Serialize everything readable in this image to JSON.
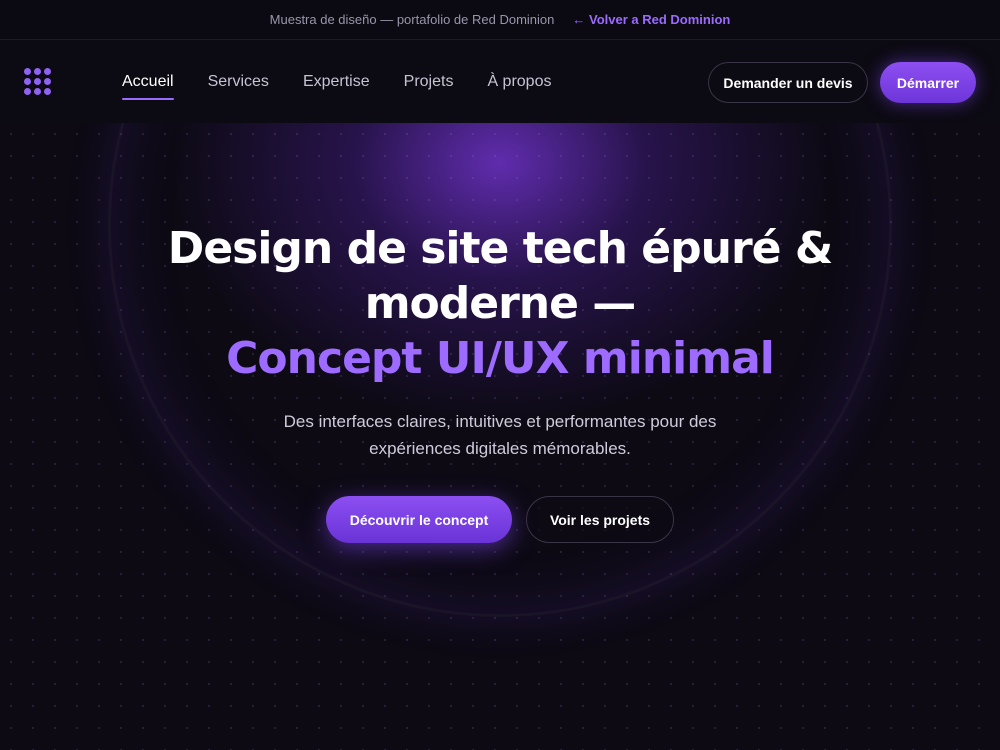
{
  "banner": {
    "text": "Muestra de diseño — portafolio de Red Dominion",
    "back_link": "← Volver a Red Dominion"
  },
  "nav": {
    "logo_icon": "dot-grid-icon",
    "links": [
      {
        "label": "Accueil",
        "active": true
      },
      {
        "label": "Services",
        "active": false
      },
      {
        "label": "Expertise",
        "active": false
      },
      {
        "label": "Projets",
        "active": false
      },
      {
        "label": "À propos",
        "active": false
      }
    ],
    "quote_button": "Demander un devis",
    "start_button": "Démarrer"
  },
  "hero": {
    "title_line1": "Design de site tech épuré &",
    "title_line2": "moderne —",
    "title_accent": "Concept UI/UX minimal",
    "subtitle": "Des interfaces claires, intuitives et performantes pour des expériences digitales mémorables.",
    "primary_button": "Découvrir le concept",
    "secondary_button": "Voir les projets"
  },
  "colors": {
    "background": "#0d0a14",
    "accent": "#9b6bff",
    "primary_button": "#7b3fe4"
  }
}
